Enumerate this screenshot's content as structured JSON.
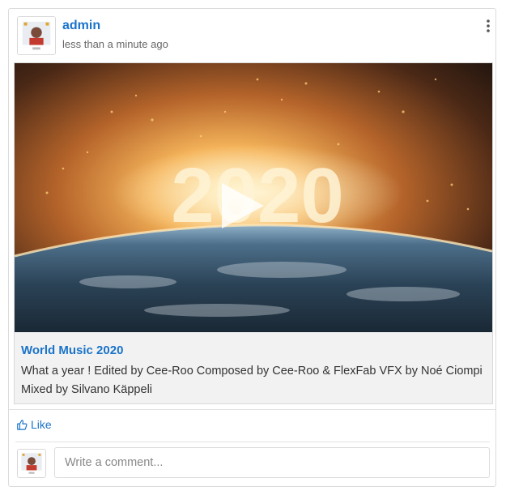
{
  "post": {
    "author": "admin",
    "timestamp": "less than a minute ago"
  },
  "video": {
    "overlay_text": "2020"
  },
  "link": {
    "title": "World Music 2020",
    "description": "What a year ! Edited by Cee-Roo Composed by Cee-Roo & FlexFab VFX by Noé Ciompi Mixed by Silvano Käppeli"
  },
  "actions": {
    "like_label": "Like"
  },
  "comment": {
    "placeholder": "Write a comment..."
  },
  "colors": {
    "accent": "#1a73c9",
    "border": "#dcdcdc"
  },
  "icons": {
    "like": "thumbs-up-icon",
    "menu": "vertical-dots-icon",
    "play": "play-icon"
  }
}
